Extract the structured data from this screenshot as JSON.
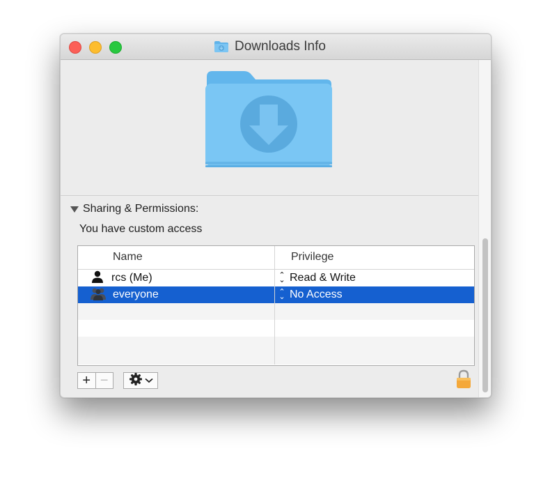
{
  "window": {
    "title": "Downloads Info",
    "title_icon": "downloads-folder-icon",
    "traffic_lights": {
      "close": "#fc5f57",
      "minimize": "#fdbd2e",
      "zoom": "#28c840"
    }
  },
  "preview": {
    "icon": "downloads-folder-icon"
  },
  "sharing": {
    "section_label": "Sharing & Permissions:",
    "access_text": "You have custom access",
    "columns": [
      "Name",
      "Privilege"
    ],
    "rows": [
      {
        "name": "rcs (Me)",
        "privilege": "Read & Write",
        "icon": "user-icon",
        "selected": false
      },
      {
        "name": "everyone",
        "privilege": "No Access",
        "icon": "group-icon",
        "selected": true
      }
    ]
  },
  "toolbar": {
    "add_label": "+",
    "remove_label": "−",
    "action_icon": "gear-icon",
    "lock_icon": "lock-icon"
  },
  "colors": {
    "selection": "#1560d0",
    "folder": "#7cc5f3"
  }
}
